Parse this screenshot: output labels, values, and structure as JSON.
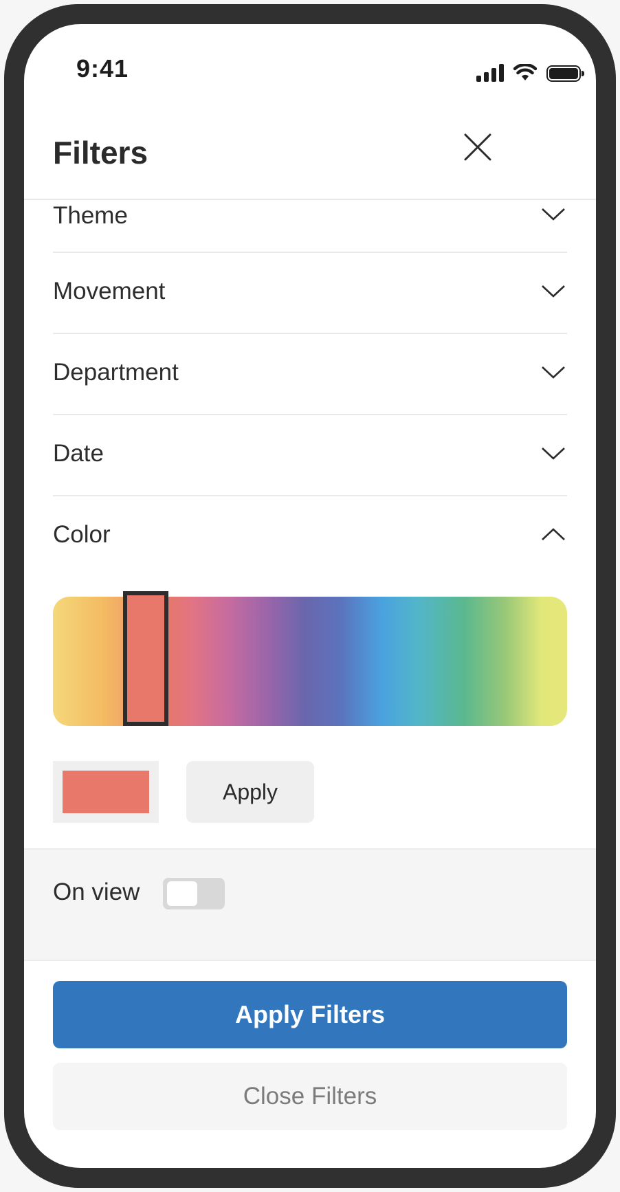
{
  "status_bar": {
    "time": "9:41"
  },
  "header": {
    "title": "Filters"
  },
  "filters": [
    {
      "label": "Theme",
      "expanded": false
    },
    {
      "label": "Movement",
      "expanded": false
    },
    {
      "label": "Department",
      "expanded": false
    },
    {
      "label": "Date",
      "expanded": false
    },
    {
      "label": "Color",
      "expanded": true
    }
  ],
  "color_picker": {
    "selected_color": "#e8786a",
    "apply_label": "Apply"
  },
  "on_view": {
    "label": "On view",
    "enabled": false
  },
  "actions": {
    "apply_filters": "Apply Filters",
    "close_filters": "Close Filters"
  },
  "colors": {
    "accent": "#3276bd",
    "frame": "#303030",
    "selected": "#e8786a"
  }
}
